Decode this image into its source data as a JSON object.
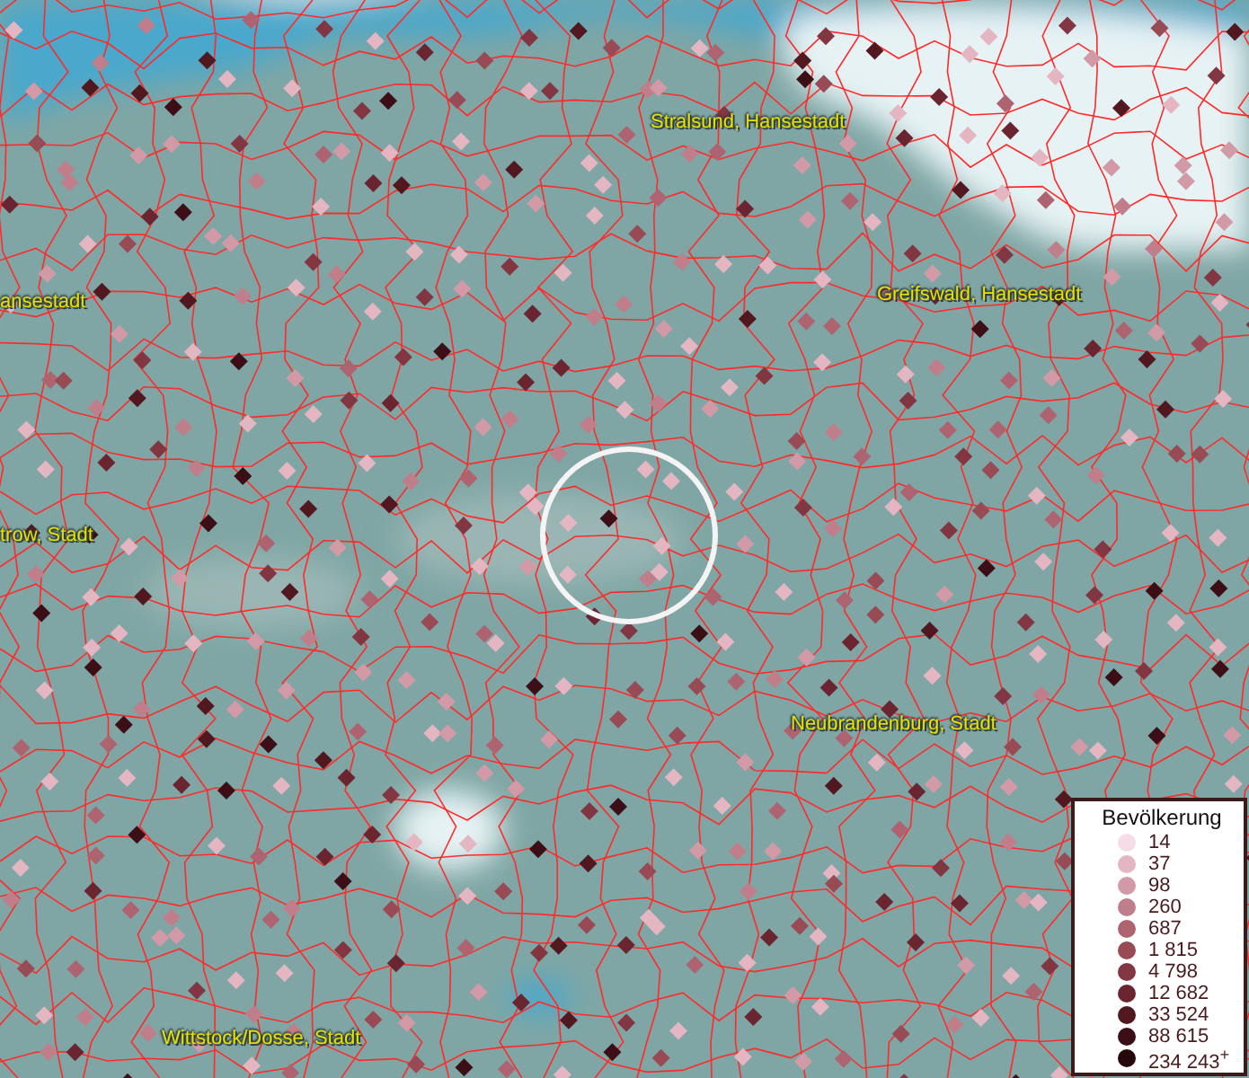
{
  "map": {
    "place_labels": [
      {
        "text": "Stralsund, Hansestadt"
      },
      {
        "text": "ansestadt"
      },
      {
        "text": "Greifswald, Hansestadt"
      },
      {
        "text": "trow, Stadt"
      },
      {
        "text": "Neubrandenburg, Stadt"
      },
      {
        "text": "Wittstock/Dosse, Stadt"
      }
    ]
  },
  "legend": {
    "title": "Bevölkerung",
    "items": [
      {
        "label": "14",
        "color": "#f5dce6"
      },
      {
        "label": "37",
        "color": "#e3b6c2"
      },
      {
        "label": "98",
        "color": "#d29aa6"
      },
      {
        "label": "260",
        "color": "#c07e8a"
      },
      {
        "label": "687",
        "color": "#ad6470"
      },
      {
        "label": "1 815",
        "color": "#984a55"
      },
      {
        "label": "4 798",
        "color": "#823642"
      },
      {
        "label": "12 682",
        "color": "#6b2530"
      },
      {
        "label": "33 524",
        "color": "#521820"
      },
      {
        "label": "88 615",
        "color": "#3b0f15"
      },
      {
        "label": "234 243$^{+}$",
        "color": "#26080b"
      }
    ]
  }
}
